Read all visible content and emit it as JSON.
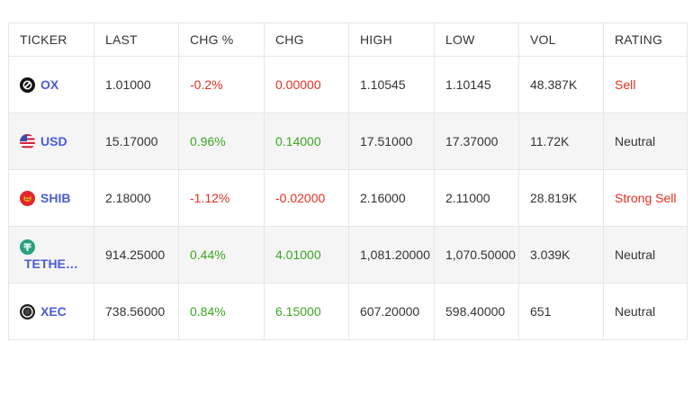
{
  "headers": [
    "TICKER",
    "LAST",
    "CHG %",
    "CHG",
    "HIGH",
    "LOW",
    "VOL",
    "RATING"
  ],
  "rows": [
    {
      "ticker": "OX",
      "icon": "ox-coin-icon",
      "last": "1.01000",
      "chg_pct": "-0.2%",
      "chg": "0.00000",
      "high": "1.10545",
      "low": "1.10145",
      "vol": "48.387K",
      "rating": "Sell"
    },
    {
      "ticker": "USD",
      "icon": "us-flag-icon",
      "last": "15.17000",
      "chg_pct": "0.96%",
      "chg": "0.14000",
      "high": "17.51000",
      "low": "17.37000",
      "vol": "11.72K",
      "rating": "Neutral"
    },
    {
      "ticker": "SHIB",
      "icon": "shib-coin-icon",
      "last": "2.18000",
      "chg_pct": "-1.12%",
      "chg": "-0.02000",
      "high": "2.16000",
      "low": "2.11000",
      "vol": "28.819K",
      "rating": "Strong Sell"
    },
    {
      "ticker": "TETHE…",
      "icon": "tether-coin-icon",
      "last": "914.25000",
      "chg_pct": "0.44%",
      "chg": "4.01000",
      "high": "1,081.20000",
      "low": "1,070.50000",
      "vol": "3.039K",
      "rating": "Neutral"
    },
    {
      "ticker": "XEC",
      "icon": "xec-coin-icon",
      "last": "738.56000",
      "chg_pct": "0.84%",
      "chg": "6.15000",
      "high": "607.20000",
      "low": "598.40000",
      "vol": "651",
      "rating": "Neutral"
    }
  ],
  "colors": {
    "negative": "#e62e1f",
    "positive": "#3aa61f",
    "ticker": "#4b5bd8",
    "alt_row": "#f5f5f5"
  }
}
